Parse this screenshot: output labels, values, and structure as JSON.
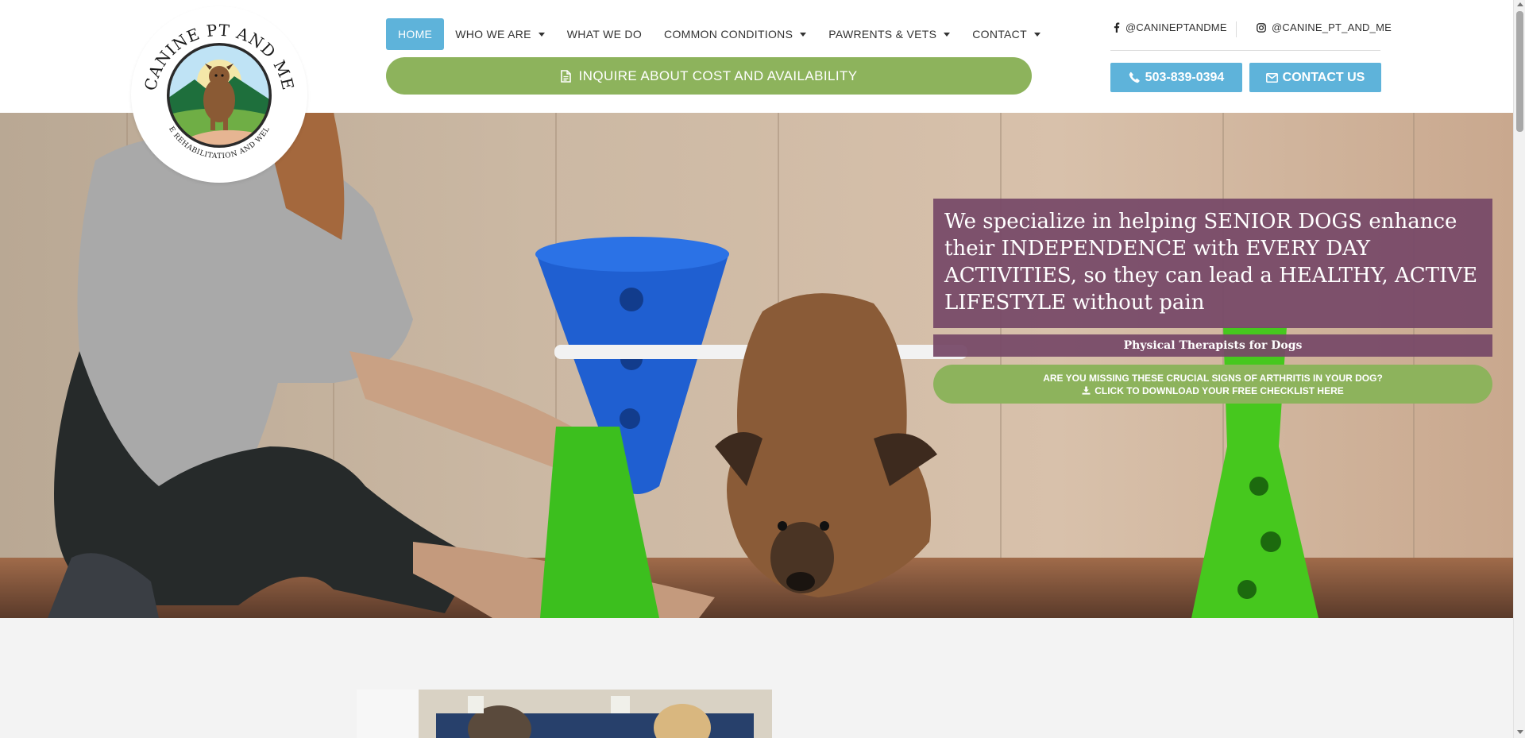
{
  "logo": {
    "name_text": "CANINE PT AND ME",
    "subtitle_text": "CANINE REHABILITATION AND WELLNESS"
  },
  "nav": {
    "items": [
      {
        "label": "HOME",
        "active": true,
        "dropdown": false
      },
      {
        "label": "WHO WE ARE",
        "active": false,
        "dropdown": true
      },
      {
        "label": "WHAT WE DO",
        "active": false,
        "dropdown": false
      },
      {
        "label": "COMMON CONDITIONS",
        "active": false,
        "dropdown": true
      },
      {
        "label": "PAWRENTS & VETS",
        "active": false,
        "dropdown": true
      },
      {
        "label": "CONTACT",
        "active": false,
        "dropdown": true
      }
    ]
  },
  "inquire": {
    "label": "INQUIRE ABOUT COST AND AVAILABILITY",
    "icon": "document-icon"
  },
  "social": {
    "facebook": {
      "handle": "@CANINEPTANDME",
      "icon": "facebook-icon"
    },
    "instagram": {
      "handle": "@CANINE_PT_AND_ME",
      "icon": "instagram-icon"
    }
  },
  "cta": {
    "phone": {
      "label": "503-839-0394",
      "icon": "phone-icon"
    },
    "contact": {
      "label": "CONTACT US",
      "icon": "envelope-icon"
    }
  },
  "hero": {
    "headline": "We specialize in helping SENIOR DOGS enhance their INDEPENDENCE with EVERY DAY ACTIVITIES, so they can lead a HEALTHY, ACTIVE LIFESTYLE without pain",
    "tagline": "Physical Therapists for Dogs",
    "checklist_line1": "ARE YOU MISSING THESE CRUCIAL SIGNS OF ARTHRITIS IN YOUR DOG?",
    "checklist_line2": "CLICK TO DOWNLOAD YOUR FREE CHECKLIST HERE",
    "checklist_icon": "download-icon"
  },
  "colors": {
    "accent_blue": "#5eb3da",
    "accent_green": "#8db35c",
    "headline_plum": "#764867"
  }
}
